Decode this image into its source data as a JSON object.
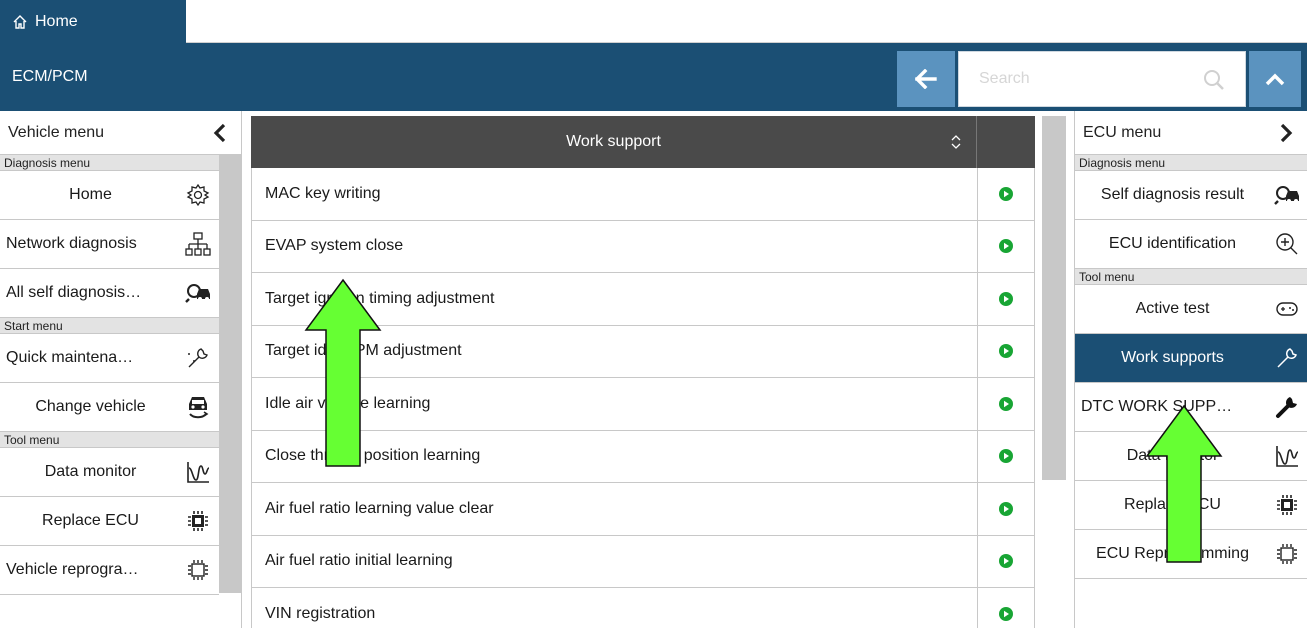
{
  "tabs": {
    "home_label": "Home"
  },
  "header": {
    "title": "ECM/PCM"
  },
  "search": {
    "placeholder": "Search"
  },
  "left_panel": {
    "title": "Vehicle menu",
    "sections": [
      {
        "label": "Diagnosis menu",
        "items": [
          {
            "label": "Home",
            "icon": "gear-icon"
          },
          {
            "label": "Network diagnosis",
            "icon": "network-icon"
          },
          {
            "label": "All self diagnosis…",
            "icon": "car-search-icon"
          }
        ]
      },
      {
        "label": "Start menu",
        "items": [
          {
            "label": "Quick maintena…",
            "icon": "wrench-sparkle-icon"
          },
          {
            "label": "Change vehicle",
            "icon": "car-refresh-icon"
          }
        ]
      },
      {
        "label": "Tool menu",
        "items": [
          {
            "label": "Data monitor",
            "icon": "waveform-icon"
          },
          {
            "label": "Replace ECU",
            "icon": "chip-icon"
          },
          {
            "label": "Vehicle reprogra…",
            "icon": "chip-outline-icon"
          }
        ]
      }
    ]
  },
  "right_panel": {
    "title": "ECU menu",
    "sections": [
      {
        "label": "Diagnosis menu",
        "items": [
          {
            "label": "Self diagnosis result",
            "icon": "car-search-icon"
          },
          {
            "label": "ECU identification",
            "icon": "zoom-in-icon"
          }
        ]
      },
      {
        "label": "Tool menu",
        "items": [
          {
            "label": "Active test",
            "icon": "gamepad-icon"
          },
          {
            "label": "Work supports",
            "icon": "wrench-icon",
            "active": true
          },
          {
            "label": "DTC WORK SUPP…",
            "icon": "wrench-solid-icon"
          },
          {
            "label": "Data monitor",
            "icon": "waveform-icon"
          },
          {
            "label": "Replace ECU",
            "icon": "chip-icon"
          },
          {
            "label": "ECU Reprogramming",
            "icon": "chip-outline-icon"
          }
        ]
      }
    ]
  },
  "work_support": {
    "header": "Work support",
    "rows": [
      "MAC key writing",
      "EVAP system close",
      "Target ignition timing adjustment",
      "Target idle RPM adjustment",
      "Idle air volume learning",
      "Close throttle position learning",
      "Air fuel ratio learning value clear",
      "Air fuel ratio initial learning",
      "VIN registration"
    ]
  },
  "colors": {
    "header_bg": "#1b4f74",
    "button_bg": "#5b93bf",
    "table_header_bg": "#4a4a4a",
    "play_green": "#18a534",
    "arrow_green": "#66ff33"
  }
}
